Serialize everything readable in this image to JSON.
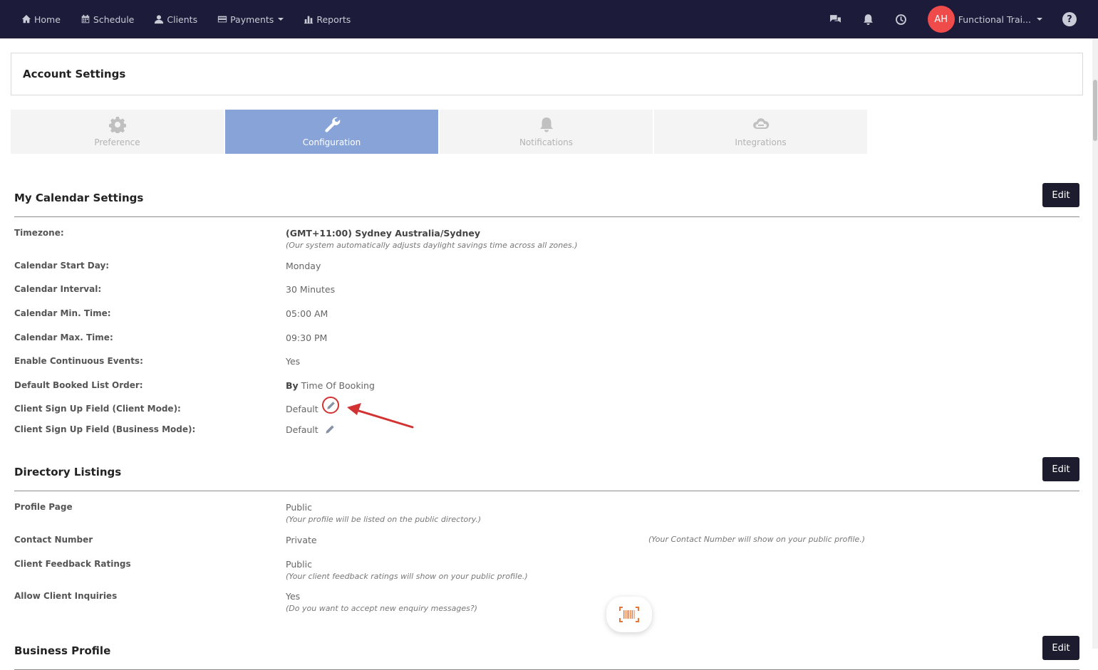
{
  "nav": {
    "home": "Home",
    "schedule": "Schedule",
    "clients": "Clients",
    "payments": "Payments",
    "reports": "Reports",
    "avatar_initials": "AH",
    "user_name": "Functional Trai..."
  },
  "page": {
    "title": "Account Settings"
  },
  "tabs": {
    "preference": "Preference",
    "configuration": "Configuration",
    "notifications": "Notifications",
    "integrations": "Integrations",
    "active": "configuration"
  },
  "calendar": {
    "title": "My Calendar Settings",
    "edit_label": "Edit",
    "timezone_label": "Timezone:",
    "timezone_value": "(GMT+11:00) Sydney Australia/Sydney",
    "timezone_note": "(Our system automatically adjusts daylight savings time across all zones.)",
    "start_day_label": "Calendar Start Day:",
    "start_day_value": "Monday",
    "interval_label": "Calendar Interval:",
    "interval_value": "30 Minutes",
    "min_time_label": "Calendar Min. Time:",
    "min_time_value": "05:00 AM",
    "max_time_label": "Calendar Max. Time:",
    "max_time_value": "09:30 PM",
    "continuous_label": "Enable Continuous Events:",
    "continuous_value": "Yes",
    "booked_order_label": "Default Booked List Order:",
    "booked_order_prefix": "By",
    "booked_order_value": "Time Of Booking",
    "signup_client_label": "Client Sign Up Field (Client Mode):",
    "signup_client_value": "Default",
    "signup_business_label": "Client Sign Up Field (Business Mode):",
    "signup_business_value": "Default"
  },
  "directory": {
    "title": "Directory Listings",
    "edit_label": "Edit",
    "profile_label": "Profile Page",
    "profile_value": "Public",
    "profile_note": "(Your profile will be listed on the public directory.)",
    "contact_label": "Contact Number",
    "contact_value": "Private",
    "contact_note": "(Your Contact Number will show on your public profile.)",
    "feedback_label": "Client Feedback Ratings",
    "feedback_value": "Public",
    "feedback_note": "(Your client feedback ratings will show on your public profile.)",
    "inquiries_label": "Allow Client Inquiries",
    "inquiries_value": "Yes",
    "inquiries_note": "(Do you want to accept new enquiry messages?)"
  },
  "business": {
    "title": "Business Profile",
    "edit_label": "Edit"
  },
  "colors": {
    "topbar": "#1c1c3a",
    "active_tab": "#87a3d8",
    "avatar": "#ef4b4b",
    "highlight": "#d23232"
  }
}
